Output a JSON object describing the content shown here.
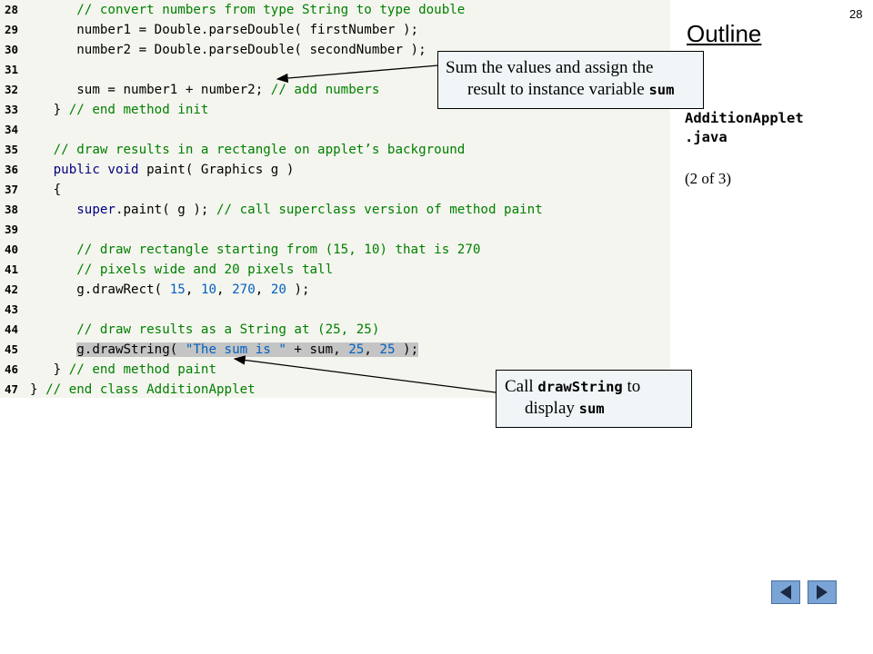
{
  "page_number": "28",
  "outline": {
    "title": "Outline",
    "file_line1": "AdditionApplet",
    "file_line2": ".java",
    "part": "(2 of 3)"
  },
  "code_lines": [
    {
      "num": "28",
      "indent": "      ",
      "parts": [
        {
          "t": "// convert numbers from type String to type double",
          "c": "cm"
        }
      ]
    },
    {
      "num": "29",
      "indent": "      ",
      "parts": [
        {
          "t": "number1 = Double.parseDouble( firstNumber );",
          "c": ""
        }
      ]
    },
    {
      "num": "30",
      "indent": "      ",
      "parts": [
        {
          "t": "number2 = Double.parseDouble( secondNumber );",
          "c": ""
        }
      ]
    },
    {
      "num": "31",
      "indent": "",
      "parts": []
    },
    {
      "num": "32",
      "indent": "      ",
      "parts": [
        {
          "t": "sum = number1 + number2; ",
          "c": ""
        },
        {
          "t": "// add numbers",
          "c": "cm"
        }
      ]
    },
    {
      "num": "33",
      "indent": "   ",
      "parts": [
        {
          "t": "} ",
          "c": ""
        },
        {
          "t": "// end method init",
          "c": "cm"
        }
      ]
    },
    {
      "num": "34",
      "indent": "",
      "parts": []
    },
    {
      "num": "35",
      "indent": "   ",
      "parts": [
        {
          "t": "// draw results in a rectangle on applet’s background",
          "c": "cm"
        }
      ]
    },
    {
      "num": "36",
      "indent": "   ",
      "parts": [
        {
          "t": "public void",
          "c": "kw"
        },
        {
          "t": " paint( Graphics g )",
          "c": ""
        }
      ]
    },
    {
      "num": "37",
      "indent": "   ",
      "parts": [
        {
          "t": "{",
          "c": ""
        }
      ]
    },
    {
      "num": "38",
      "indent": "      ",
      "parts": [
        {
          "t": "super",
          "c": "kw"
        },
        {
          "t": ".paint( g ); ",
          "c": ""
        },
        {
          "t": "// call superclass version of method paint",
          "c": "cm"
        }
      ]
    },
    {
      "num": "39",
      "indent": "",
      "parts": []
    },
    {
      "num": "40",
      "indent": "      ",
      "parts": [
        {
          "t": "// draw rectangle starting from (15, 10) that is 270",
          "c": "cm"
        }
      ]
    },
    {
      "num": "41",
      "indent": "      ",
      "parts": [
        {
          "t": "// pixels wide and 20 pixels tall",
          "c": "cm"
        }
      ]
    },
    {
      "num": "42",
      "indent": "      ",
      "parts": [
        {
          "t": "g.drawRect( ",
          "c": ""
        },
        {
          "t": "15",
          "c": "num"
        },
        {
          "t": ", ",
          "c": ""
        },
        {
          "t": "10",
          "c": "num"
        },
        {
          "t": ", ",
          "c": ""
        },
        {
          "t": "270",
          "c": "num"
        },
        {
          "t": ", ",
          "c": ""
        },
        {
          "t": "20",
          "c": "num"
        },
        {
          "t": " );",
          "c": ""
        }
      ]
    },
    {
      "num": "43",
      "indent": "",
      "parts": []
    },
    {
      "num": "44",
      "indent": "      ",
      "parts": [
        {
          "t": "// draw results as a String at (25, 25)",
          "c": "cm"
        }
      ]
    },
    {
      "num": "45",
      "indent": "      ",
      "parts": [
        {
          "t": "g.drawString( ",
          "c": "hl"
        },
        {
          "t": "\"The sum is \"",
          "c": "hl str"
        },
        {
          "t": " + sum, ",
          "c": "hl"
        },
        {
          "t": "25",
          "c": "hl num"
        },
        {
          "t": ", ",
          "c": "hl"
        },
        {
          "t": "25",
          "c": "hl num"
        },
        {
          "t": " );",
          "c": "hl"
        }
      ]
    },
    {
      "num": "46",
      "indent": "   ",
      "parts": [
        {
          "t": "} ",
          "c": ""
        },
        {
          "t": "// end method paint",
          "c": "cm"
        }
      ]
    },
    {
      "num": "47",
      "indent": "",
      "parts": [
        {
          "t": "} ",
          "c": ""
        },
        {
          "t": "// end class AdditionApplet",
          "c": "cm"
        }
      ]
    }
  ],
  "callout_sum": {
    "line1": "Sum the values and assign the",
    "line2_text": "result to instance variable ",
    "line2_code": "sum"
  },
  "callout_draw": {
    "line1_text": "Call ",
    "line1_code": "drawString",
    "line1_after": " to",
    "line2_text": "display ",
    "line2_code": "sum"
  },
  "nav": {
    "prev_icon": "triangle-left-icon",
    "next_icon": "triangle-right-icon"
  }
}
